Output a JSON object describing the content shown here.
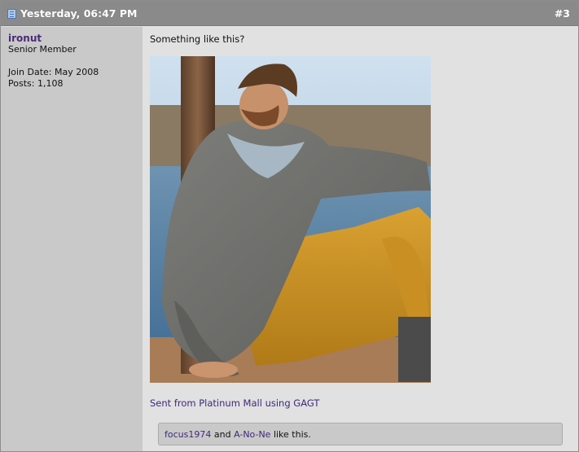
{
  "post": {
    "date": "Yesterday, 06:47 PM",
    "number": "#3"
  },
  "user": {
    "name": "ironut",
    "title": "Senior Member",
    "join_date": "Join Date: May 2008",
    "posts": "Posts: 1,108"
  },
  "message": {
    "text": "Something like this?",
    "image_icon": "photo-of-man-in-grey-hoodie-and-mustard-chinos",
    "signature": "Sent from Platinum Mall using GAGT"
  },
  "likes": {
    "user1": "focus1974",
    "and": " and ",
    "user2": "A-No-Ne",
    "suffix": " like this."
  },
  "colors": {
    "header_bg": "#8a8a8a",
    "user_col_bg": "#c9c9c9",
    "content_bg": "#e1e1e1",
    "link": "#3d2a7a",
    "username": "#4b2b78"
  }
}
